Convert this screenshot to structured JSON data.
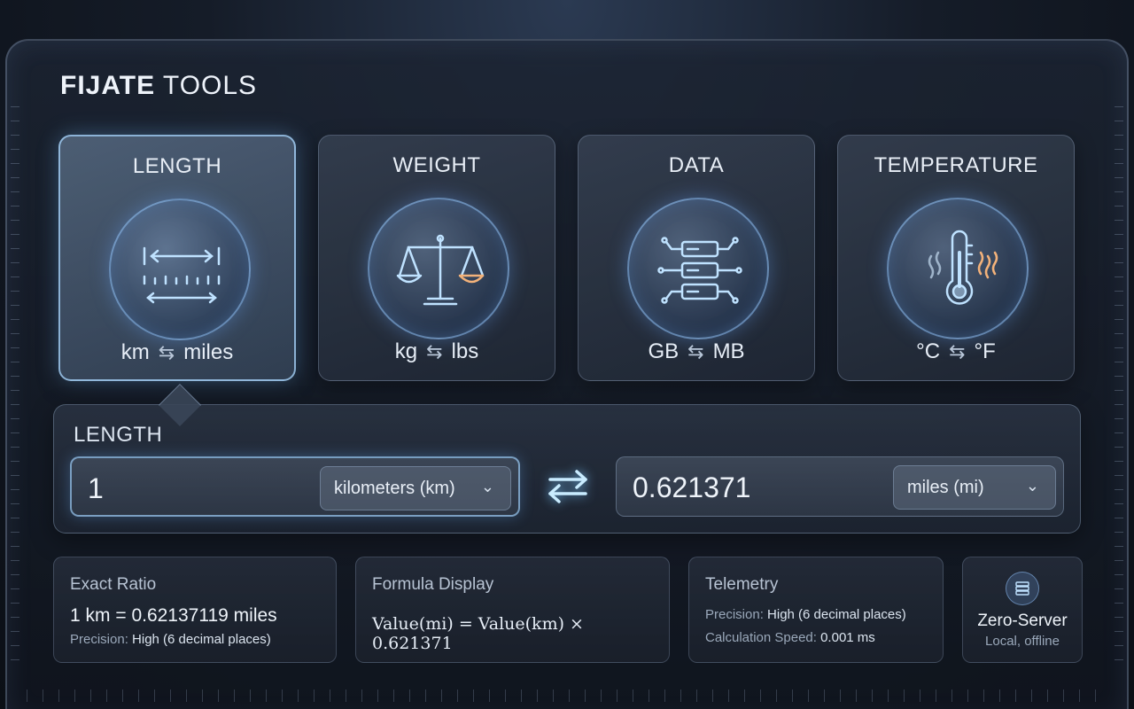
{
  "app": {
    "brand_bold": "FIJATE",
    "brand_light": "TOOLS"
  },
  "categories": [
    {
      "title": "LENGTH",
      "from": "km",
      "to": "miles",
      "icon": "ruler-icon",
      "active": true
    },
    {
      "title": "WEIGHT",
      "from": "kg",
      "to": "lbs",
      "icon": "scale-icon",
      "active": false
    },
    {
      "title": "DATA",
      "from": "GB",
      "to": "MB",
      "icon": "server-icon",
      "active": false
    },
    {
      "title": "TEMPERATURE",
      "from": "°C",
      "to": "°F",
      "icon": "thermometer-icon",
      "active": false
    }
  ],
  "swap_glyph": "⇆",
  "converter": {
    "title": "LENGTH",
    "input_value": "1",
    "input_unit": "kilometers (km)",
    "output_value": "0.621371",
    "output_unit": "miles (mi)",
    "chevron": "⌄"
  },
  "exact_ratio": {
    "title": "Exact Ratio",
    "value": "1 km = 0.62137119 miles",
    "precision_label": "Precision:",
    "precision_value": "High (6 decimal places)"
  },
  "formula": {
    "title": "Formula Display",
    "expression": "Value(mi) = Value(km) × 0.621371"
  },
  "telemetry": {
    "title": "Telemetry",
    "precision_label": "Precision:",
    "precision_value": "High (6 decimal places)",
    "speed_label": "Calculation Speed:",
    "speed_value": "0.001 ms"
  },
  "zero_server": {
    "title": "Zero-Server",
    "subtitle": "Local, offline",
    "icon": "server-icon"
  },
  "colors": {
    "accent": "#8fd0ff",
    "icon_blue": "#9fd4ff",
    "icon_orange": "#f3b27a"
  }
}
